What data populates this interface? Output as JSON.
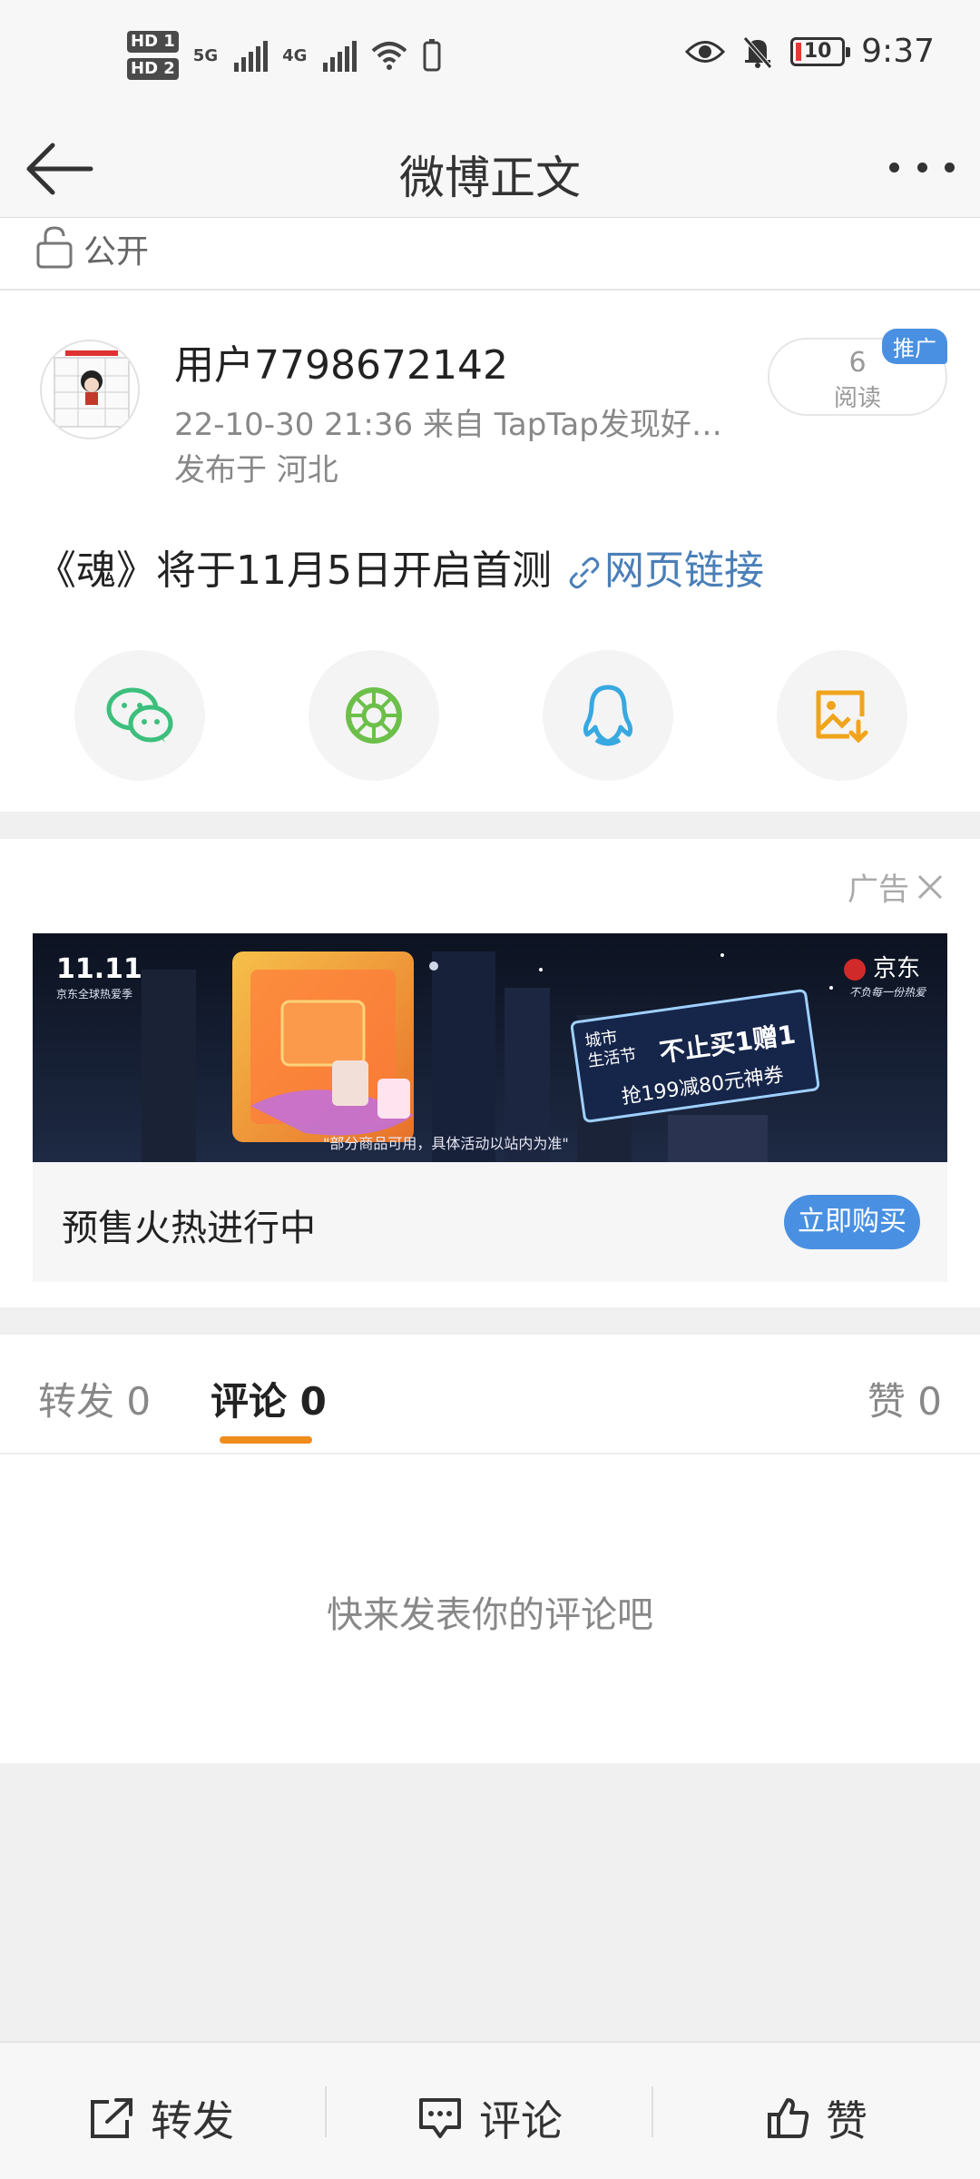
{
  "status_bar": {
    "hd1": "HD 1",
    "hd2": "HD 2",
    "net1": "5G",
    "net2": "4G",
    "battery": "10",
    "time": "9:37"
  },
  "nav": {
    "title": "微博正文"
  },
  "visibility": {
    "label": "公开"
  },
  "post": {
    "username": "用户7798672142",
    "meta": "22-10-30 21:36   来自 TapTap发现好…",
    "location": "发布于 河北",
    "read_count": "6",
    "read_label": "阅读",
    "promo_tag": "推广",
    "text": "《魂》将于11月5日开启首测",
    "link_text": "网页链接"
  },
  "share": {
    "icons": [
      "wechat-icon",
      "moments-icon",
      "qq-icon",
      "save-image-icon"
    ]
  },
  "ad": {
    "label": "广告",
    "banner_top_left": "11.11",
    "banner_sub": "京东全球热爱季",
    "banner_brand": "京东",
    "banner_slogan": "不负每一份热爱",
    "banner_headline": "不止买1赠1",
    "banner_city": "城市\n生活节",
    "banner_offer": "抢199减80元神券",
    "banner_note": "\"部分商品可用，具体活动以站内为准\"",
    "title": "预售火热进行中",
    "cta": "立即购买",
    "colors": {
      "cta": "#4a90e2"
    }
  },
  "tabs": {
    "repost": "转发 0",
    "comment": "评论 0",
    "like": "赞 0",
    "active": "comment",
    "underline_color": "#f08c1c"
  },
  "comments": {
    "empty_text": "快来发表你的评论吧"
  },
  "toolbar": {
    "repost": "转发",
    "comment": "评论",
    "like": "赞"
  }
}
